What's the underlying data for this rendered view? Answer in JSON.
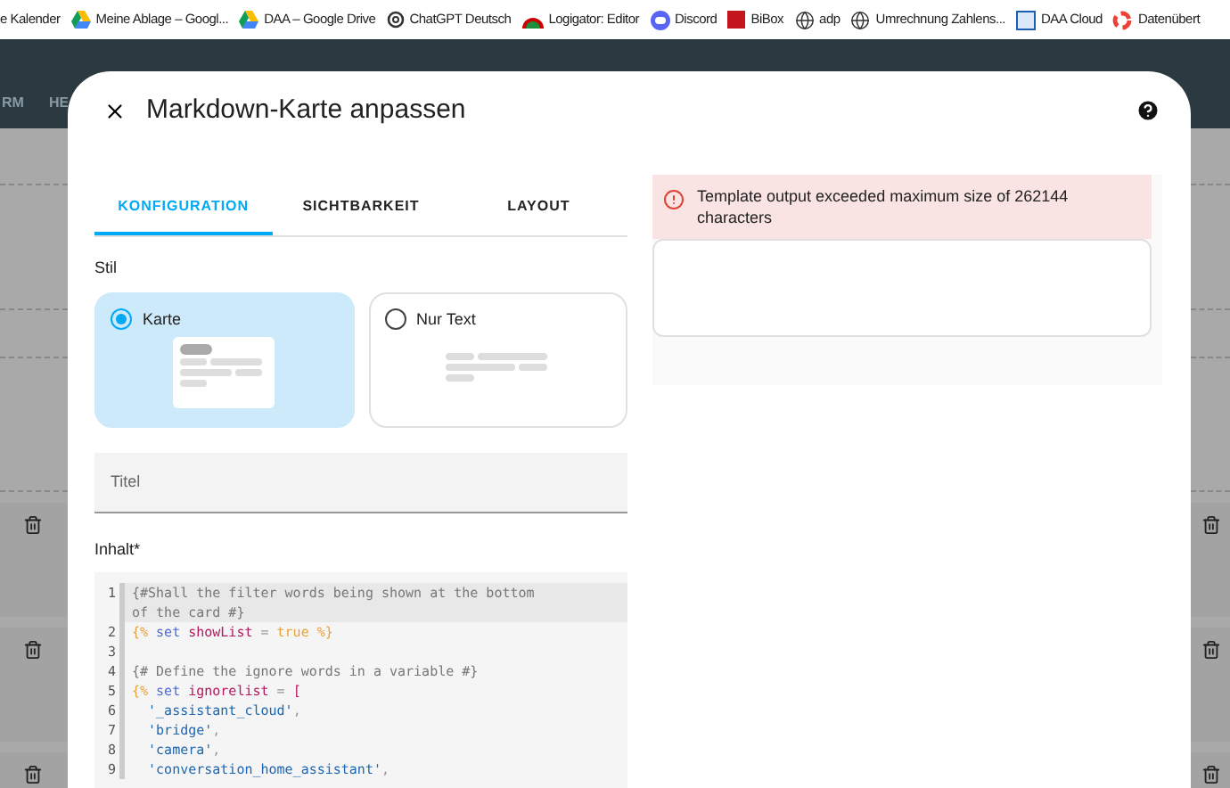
{
  "bookmarks": [
    {
      "label": "e Kalender",
      "kind": "none"
    },
    {
      "label": "Meine Ablage – Googl...",
      "kind": "drive"
    },
    {
      "label": "DAA – Google Drive",
      "kind": "drive"
    },
    {
      "label": "ChatGPT Deutsch",
      "kind": "knot"
    },
    {
      "label": "Logigator: Editor",
      "kind": "logo"
    },
    {
      "label": "Discord",
      "kind": "chat"
    },
    {
      "label": "BiBox",
      "kind": "box"
    },
    {
      "label": "adp",
      "kind": "globe"
    },
    {
      "label": "Umrechnung Zahlens...",
      "kind": "globe"
    },
    {
      "label": "DAA Cloud",
      "kind": "cloud"
    },
    {
      "label": "Datenübert",
      "kind": "ring"
    }
  ],
  "background_nav": [
    "RM",
    "HE"
  ],
  "dialog": {
    "title": "Markdown-Karte anpassen",
    "tabs": [
      {
        "label": "KONFIGURATION",
        "selected": true
      },
      {
        "label": "SICHTBARKEIT",
        "selected": false
      },
      {
        "label": "LAYOUT",
        "selected": false
      }
    ],
    "style_label": "Stil",
    "style_options": [
      {
        "label": "Karte",
        "selected": true
      },
      {
        "label": "Nur Text",
        "selected": false
      }
    ],
    "title_field": {
      "placeholder": "Titel"
    },
    "content_label": "Inhalt*",
    "code_lines": [
      {
        "number": "1",
        "active": true,
        "tokens": [
          {
            "kind": "comment",
            "text": "{#Shall the filter words being shown at the bottom of the card #}"
          }
        ]
      },
      {
        "number": "2",
        "active": false,
        "tokens": [
          {
            "kind": "delim",
            "text": "{%"
          },
          {
            "kind": "keyword",
            "text": " set "
          },
          {
            "kind": "var",
            "text": "showList"
          },
          {
            "kind": "op",
            "text": " = "
          },
          {
            "kind": "bool",
            "text": "true"
          },
          {
            "kind": "delim",
            "text": " %}"
          }
        ]
      },
      {
        "number": "3",
        "active": false
      },
      {
        "number": "4",
        "active": false,
        "tokens": [
          {
            "kind": "comment",
            "text": "{# Define the ignore words in a variable #}"
          }
        ]
      },
      {
        "number": "5",
        "active": false,
        "tokens": [
          {
            "kind": "delim",
            "text": "{%"
          },
          {
            "kind": "keyword",
            "text": " set "
          },
          {
            "kind": "var",
            "text": "ignorelist"
          },
          {
            "kind": "op",
            "text": " = "
          },
          {
            "kind": "var",
            "text": "["
          }
        ]
      },
      {
        "number": "6",
        "active": false,
        "tokens": [
          {
            "kind": "string",
            "text": "  '_assistant_cloud'"
          },
          {
            "kind": "op",
            "text": ","
          }
        ]
      },
      {
        "number": "7",
        "active": false,
        "tokens": [
          {
            "kind": "string",
            "text": "  'bridge'"
          },
          {
            "kind": "op",
            "text": ","
          }
        ]
      },
      {
        "number": "8",
        "active": false,
        "tokens": [
          {
            "kind": "string",
            "text": "  'camera'"
          },
          {
            "kind": "op",
            "text": ","
          }
        ]
      },
      {
        "number": "9",
        "active": false,
        "tokens": [
          {
            "kind": "string",
            "text": "  'conversation_home_assistant'"
          },
          {
            "kind": "op",
            "text": ","
          }
        ]
      }
    ],
    "error": "Template output exceeded maximum size of 262144 characters"
  }
}
